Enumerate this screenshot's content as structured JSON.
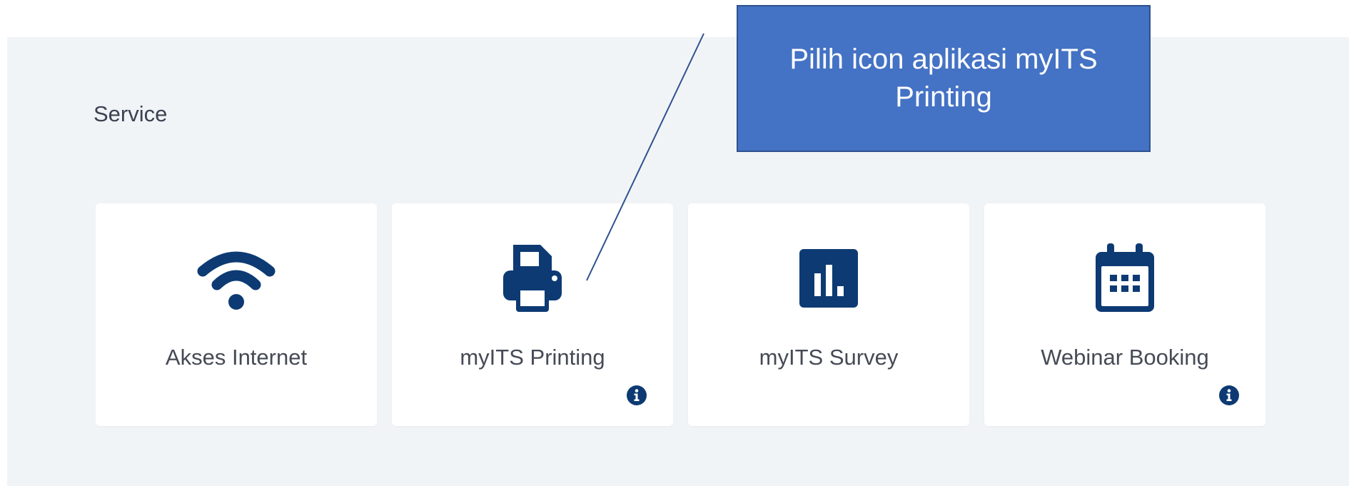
{
  "section": {
    "title": "Service"
  },
  "cards": [
    {
      "label": "Akses Internet",
      "icon": "wifi-icon",
      "has_info": false
    },
    {
      "label": "myITS Printing",
      "icon": "printer-icon",
      "has_info": true
    },
    {
      "label": "myITS Survey",
      "icon": "bar-chart-icon",
      "has_info": false
    },
    {
      "label": "Webinar Booking",
      "icon": "calendar-icon",
      "has_info": true
    }
  ],
  "callout": {
    "text": "Pilih icon aplikasi myITS Printing"
  },
  "colors": {
    "panel_bg": "#f1f4f7",
    "icon": "#0d3a73",
    "callout_bg": "#4472c4",
    "callout_border": "#2f528f"
  }
}
